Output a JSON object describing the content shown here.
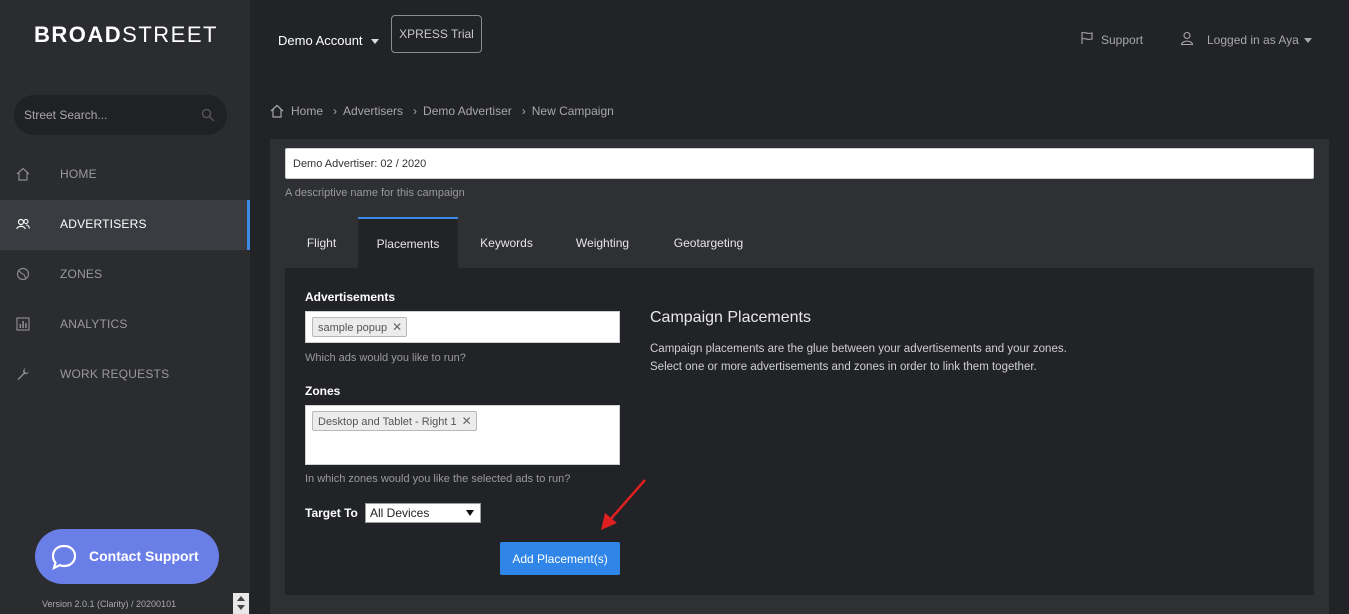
{
  "brand": {
    "part1": "BROAD",
    "part2": "STREET"
  },
  "sidebar": {
    "search_placeholder": "Street Search...",
    "items": [
      {
        "label": "HOME",
        "icon": "home-icon",
        "active": false
      },
      {
        "label": "ADVERTISERS",
        "icon": "users-icon",
        "active": true
      },
      {
        "label": "ZONES",
        "icon": "globe-icon",
        "active": false
      },
      {
        "label": "ANALYTICS",
        "icon": "chart-icon",
        "active": false
      },
      {
        "label": "WORK REQUESTS",
        "icon": "wrench-icon",
        "active": false
      }
    ],
    "contact_label": "Contact Support",
    "version": "Version 2.0.1 (Clarity) / 20200101"
  },
  "header": {
    "account": "Demo Account",
    "xpress": "XPRESS Trial",
    "support": "Support",
    "user": "Logged in as Aya"
  },
  "breadcrumb": [
    "Home",
    "Advertisers",
    "Demo Advertiser",
    "New Campaign"
  ],
  "campaign": {
    "name_value": "Demo Advertiser: 02 / 2020",
    "name_help": "A descriptive name for this campaign"
  },
  "tabs": [
    "Flight",
    "Placements",
    "Keywords",
    "Weighting",
    "Geotargeting"
  ],
  "placements": {
    "ads_label": "Advertisements",
    "ads_chip": "sample popup",
    "ads_help": "Which ads would you like to run?",
    "zones_label": "Zones",
    "zones_chip": "Desktop and Tablet - Right 1",
    "zones_help": "In which zones would you like the selected ads to run?",
    "target_label": "Target To",
    "target_value": "All Devices",
    "add_button": "Add Placement(s)",
    "info_title": "Campaign Placements",
    "info_line1": "Campaign placements are the glue between your advertisements and your zones.",
    "info_line2": "Select one or more advertisements and zones in order to link them together."
  },
  "colors": {
    "accent": "#3c8ae6",
    "button": "#2f86e8",
    "contact": "#6a7ee8",
    "annotation_arrow": "#e02020"
  }
}
